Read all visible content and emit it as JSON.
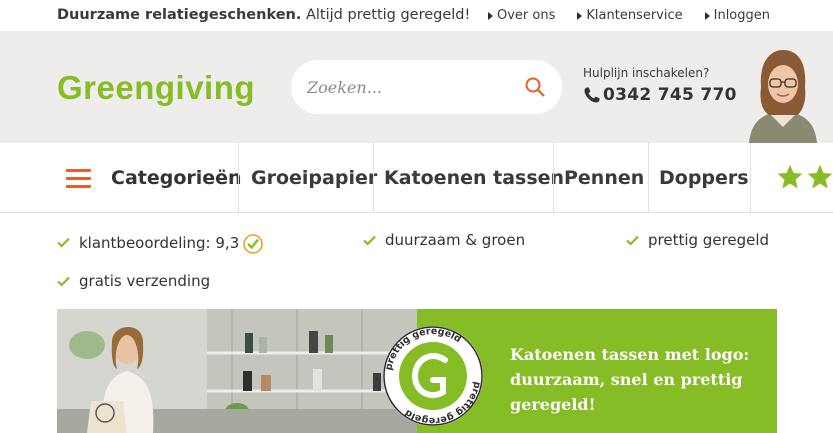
{
  "topbar": {
    "tagline_bold": "Duurzame relatiegeschenken.",
    "tagline_rest": " Altijd prettig geregeld!",
    "links": [
      "Over ons",
      "Klantenservice",
      "Inloggen"
    ]
  },
  "header": {
    "logo_text": "Greengiving",
    "search_placeholder": "Zoeken...",
    "hotline_label": "Hulplijn inschakelen?",
    "hotline_phone": "0342 745 770"
  },
  "nav": {
    "categories_label": "Categorieën",
    "items": [
      "Groeipapier",
      "Katoenen tassen",
      "Pennen",
      "Doppers"
    ]
  },
  "usps": {
    "rating": "klantbeoordeling: 9,3",
    "green": "duurzaam & groen",
    "arranged": "prettig geregeld",
    "shipping": "gratis verzending"
  },
  "banner": {
    "headline": "Katoenen tassen met logo: duurzaam, snel en prettig geregeld!",
    "seal_text": "prettig geregeld"
  },
  "colors": {
    "brand_green": "#86bc25",
    "accent_orange": "#e85d2a",
    "header_bg": "#efedeb"
  }
}
